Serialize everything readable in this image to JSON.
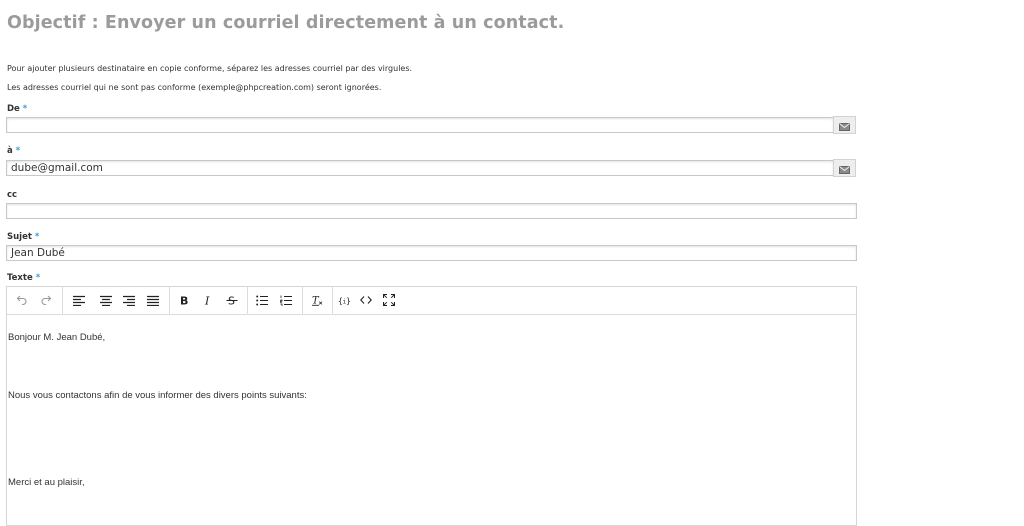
{
  "page": {
    "title": "Objectif : Envoyer un courriel directement à un contact.",
    "note_1": "Pour ajouter plusieurs destinataire en copie conforme, séparez les adresses courriel par des virgules.",
    "note_2": "Les adresses courriel qui ne sont pas conforme (exemple@phpcreation.com) seront ignorées."
  },
  "form": {
    "required_mark": "*",
    "from": {
      "label": "De",
      "value": "",
      "icon": "envelope-icon"
    },
    "to": {
      "label": "à",
      "value": "dube@gmail.com",
      "icon": "envelope-icon"
    },
    "cc": {
      "label": "cc",
      "value": ""
    },
    "subject": {
      "label": "Sujet",
      "value": "Jean Dubé"
    },
    "body": {
      "label": "Texte",
      "lines": [
        "Bonjour M. Jean Dubé,",
        "Nous vous contactons afin de vous informer des divers points suivants:",
        "Merci et au plaisir,"
      ]
    }
  },
  "toolbar": {
    "buttons": [
      "undo-icon",
      "redo-icon",
      "align-left-icon",
      "align-center-icon",
      "align-right-icon",
      "align-justify-icon",
      "bold-icon",
      "italic-icon",
      "strikethrough-icon",
      "bullet-list-icon",
      "numbered-list-icon",
      "clear-formatting-icon",
      "variable-icon",
      "source-code-icon",
      "fullscreen-icon"
    ]
  },
  "colors": {
    "title": "#9b9b9b",
    "required": "#3d9ad1",
    "border": "#c8c8c8",
    "addon_bg": "#eeeeee"
  }
}
